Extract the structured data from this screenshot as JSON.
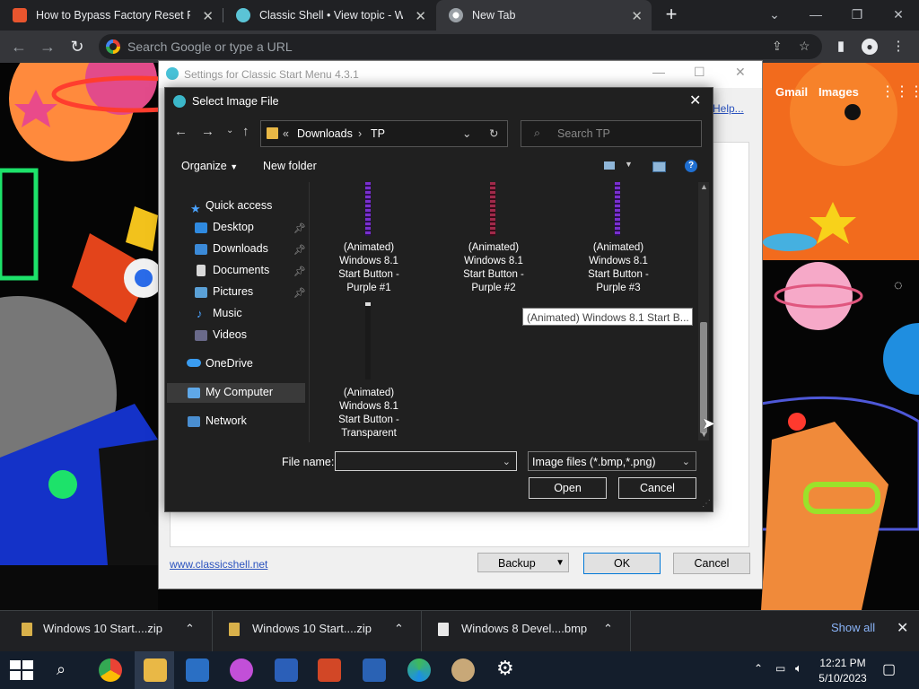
{
  "browser": {
    "tabs": [
      {
        "label": "How to Bypass Factory Reset Pro",
        "active": false
      },
      {
        "label": "Classic Shell • View topic - Windo",
        "active": false
      },
      {
        "label": "New Tab",
        "active": true
      }
    ],
    "omnibox_placeholder": "Search Google or type a URL",
    "ntp_links": {
      "gmail": "Gmail",
      "images": "Images"
    }
  },
  "settings_window": {
    "title": "Settings for Classic Start Menu 4.3.1",
    "help_link": "Help...",
    "website_link": "www.classicshell.net",
    "backup_label": "Backup",
    "ok_label": "OK",
    "cancel_label": "Cancel"
  },
  "dialog": {
    "title": "Select Image File",
    "breadcrumb": {
      "prefix": "«",
      "parts": [
        "Downloads",
        "TP"
      ]
    },
    "search_placeholder": "Search TP",
    "toolbar": {
      "organize": "Organize",
      "new_folder": "New folder"
    },
    "nav": [
      {
        "label": "Quick access",
        "pinned": false
      },
      {
        "label": "Desktop",
        "pinned": true
      },
      {
        "label": "Downloads",
        "pinned": true
      },
      {
        "label": "Documents",
        "pinned": true
      },
      {
        "label": "Pictures",
        "pinned": true
      },
      {
        "label": "Music",
        "pinned": false
      },
      {
        "label": "Videos",
        "pinned": false
      },
      {
        "label": "OneDrive",
        "pinned": false
      },
      {
        "label": "My Computer",
        "pinned": false,
        "selected": true
      },
      {
        "label": "Network",
        "pinned": false
      }
    ],
    "files": [
      {
        "lines": [
          "(Animated)",
          "Windows 8.1",
          "Start Button -",
          "Purple #1"
        ]
      },
      {
        "lines": [
          "(Animated)",
          "Windows 8.1",
          "Start Button -",
          "Purple #2"
        ]
      },
      {
        "lines": [
          "(Animated)",
          "Windows 8.1",
          "Start Button -",
          "Purple #3"
        ]
      },
      {
        "lines": [
          "(Animated)",
          "Windows 8.1",
          "Start Button -",
          "Transparent"
        ]
      }
    ],
    "tooltip": "(Animated) Windows 8.1 Start B...",
    "file_name_label": "File name:",
    "file_name_value": "",
    "file_type": "Image files (*.bmp,*.png)",
    "open_label": "Open",
    "cancel_label": "Cancel"
  },
  "downloads": {
    "items": [
      "Windows 10 Start....zip",
      "Windows 10 Start....zip",
      "Windows 8 Devel....bmp"
    ],
    "show_all": "Show all"
  },
  "taskbar": {
    "time": "12:21 PM",
    "date": "5/10/2023"
  }
}
